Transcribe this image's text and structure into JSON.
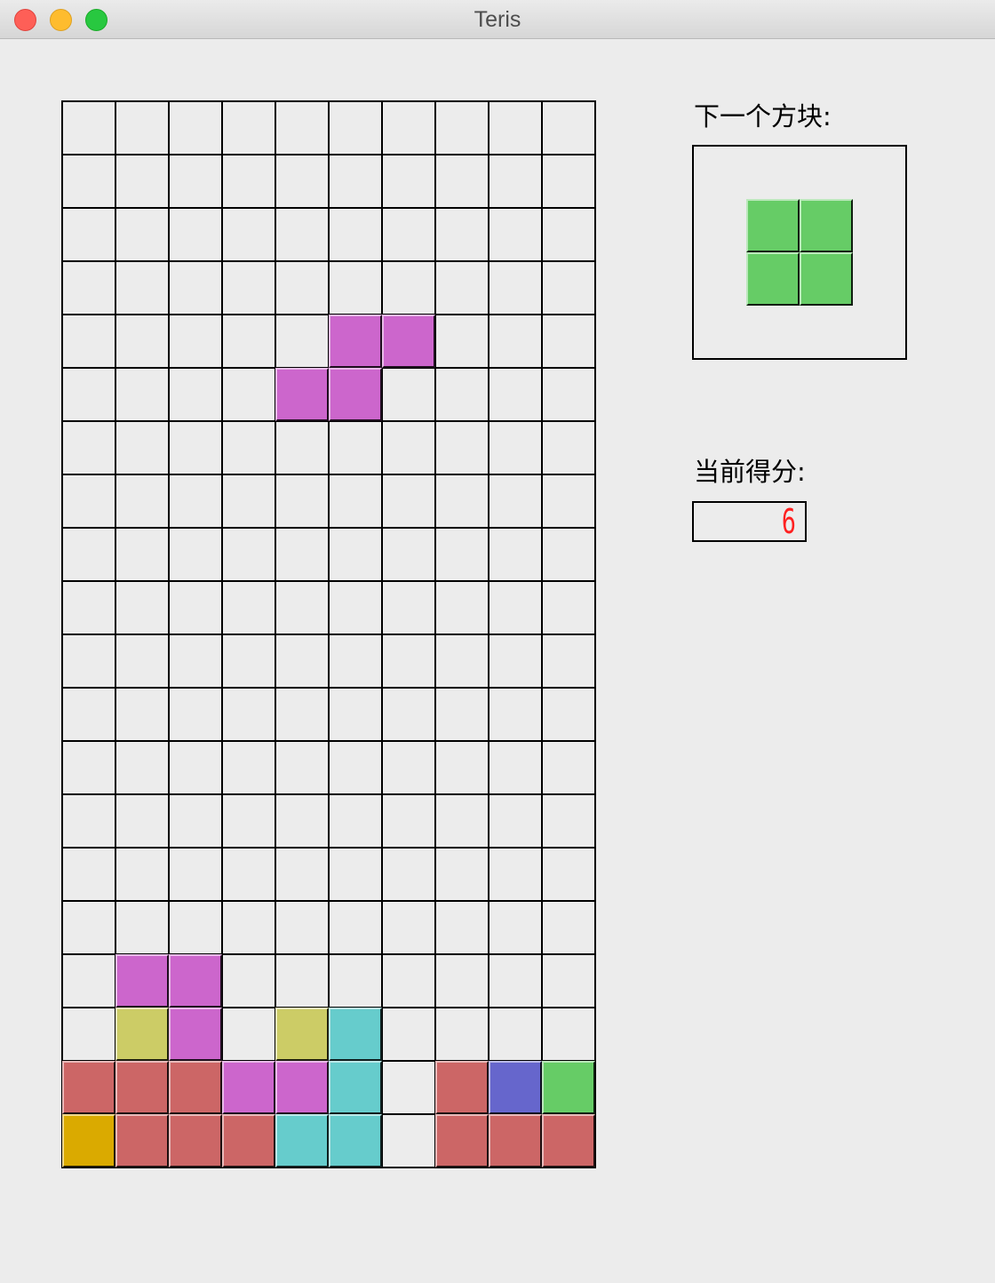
{
  "window": {
    "title": "Teris"
  },
  "colors": {
    "empty": "#ececec",
    "grid_line": "#000000",
    "magenta": "#cc66cc",
    "olive": "#cccc66",
    "cyan": "#66cccc",
    "red": "#cc6666",
    "blue": "#6666cc",
    "green": "#66cc66",
    "gold": "#daaa00"
  },
  "board": {
    "cols": 10,
    "rows": 20,
    "cells": [
      {
        "r": 4,
        "c": 5,
        "color": "magenta"
      },
      {
        "r": 4,
        "c": 6,
        "color": "magenta"
      },
      {
        "r": 5,
        "c": 4,
        "color": "magenta"
      },
      {
        "r": 5,
        "c": 5,
        "color": "magenta"
      },
      {
        "r": 16,
        "c": 1,
        "color": "magenta"
      },
      {
        "r": 16,
        "c": 2,
        "color": "magenta"
      },
      {
        "r": 17,
        "c": 1,
        "color": "olive"
      },
      {
        "r": 17,
        "c": 2,
        "color": "magenta"
      },
      {
        "r": 17,
        "c": 4,
        "color": "olive"
      },
      {
        "r": 17,
        "c": 5,
        "color": "cyan"
      },
      {
        "r": 18,
        "c": 0,
        "color": "red"
      },
      {
        "r": 18,
        "c": 1,
        "color": "red"
      },
      {
        "r": 18,
        "c": 2,
        "color": "red"
      },
      {
        "r": 18,
        "c": 3,
        "color": "magenta"
      },
      {
        "r": 18,
        "c": 4,
        "color": "magenta"
      },
      {
        "r": 18,
        "c": 5,
        "color": "cyan"
      },
      {
        "r": 18,
        "c": 7,
        "color": "red"
      },
      {
        "r": 18,
        "c": 8,
        "color": "blue"
      },
      {
        "r": 18,
        "c": 9,
        "color": "green"
      },
      {
        "r": 19,
        "c": 0,
        "color": "gold"
      },
      {
        "r": 19,
        "c": 1,
        "color": "red"
      },
      {
        "r": 19,
        "c": 2,
        "color": "red"
      },
      {
        "r": 19,
        "c": 3,
        "color": "red"
      },
      {
        "r": 19,
        "c": 4,
        "color": "cyan"
      },
      {
        "r": 19,
        "c": 5,
        "color": "cyan"
      },
      {
        "r": 19,
        "c": 7,
        "color": "red"
      },
      {
        "r": 19,
        "c": 8,
        "color": "red"
      },
      {
        "r": 19,
        "c": 9,
        "color": "red"
      }
    ]
  },
  "next_piece": {
    "label": "下一个方块:",
    "color": "green",
    "cells": [
      {
        "r": 0,
        "c": 0
      },
      {
        "r": 0,
        "c": 1
      },
      {
        "r": 1,
        "c": 0
      },
      {
        "r": 1,
        "c": 1
      }
    ]
  },
  "score": {
    "label": "当前得分:",
    "value": "6"
  }
}
